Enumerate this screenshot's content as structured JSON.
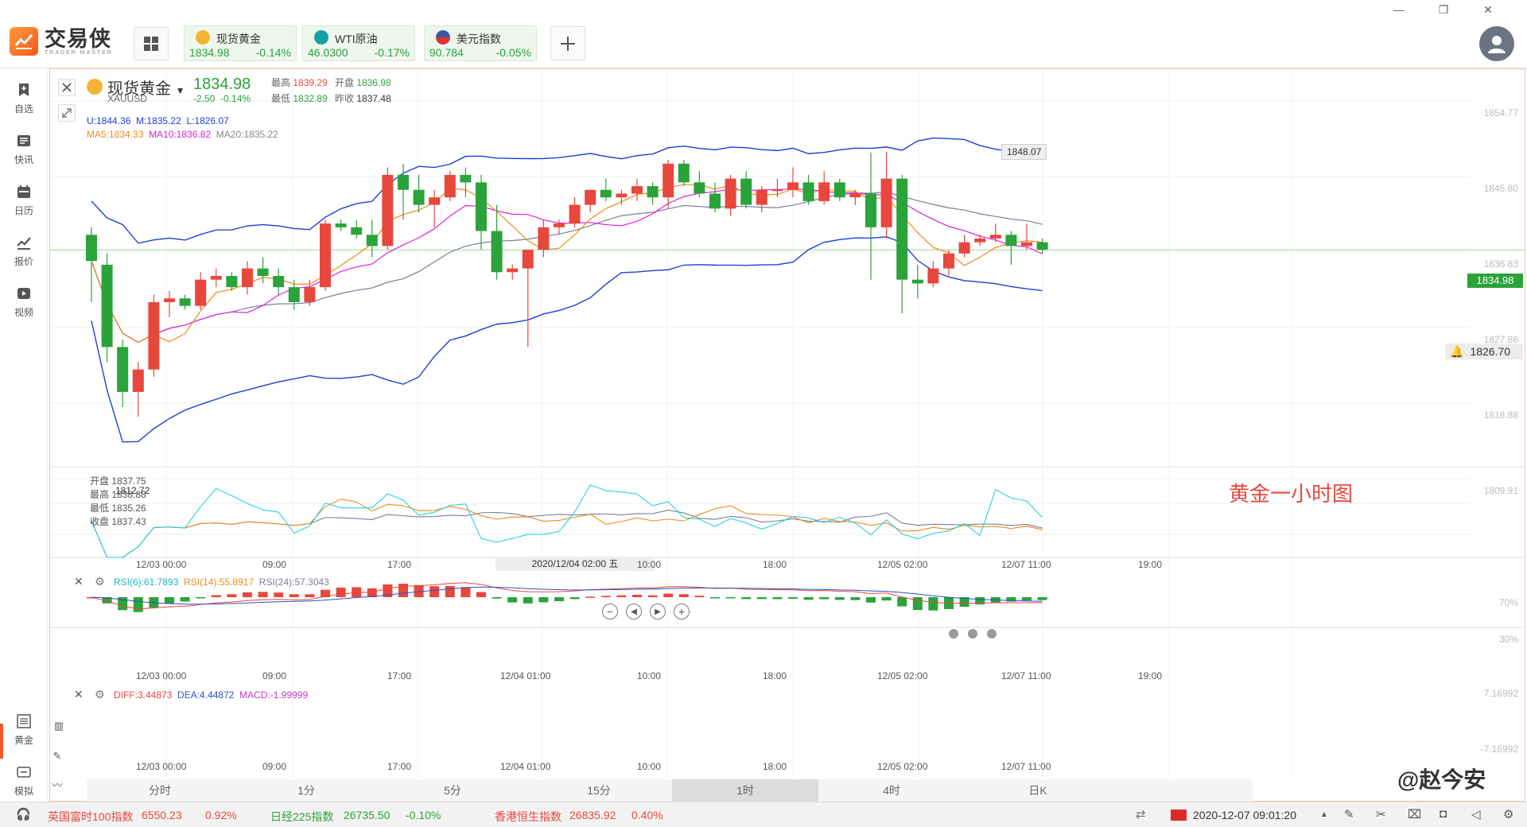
{
  "app": {
    "name_cn": "交易侠",
    "name_en": "TRADER MASTER"
  },
  "tickers": [
    {
      "name": "现货黄金",
      "price": "1834.98",
      "change": "-0.14%",
      "icon_color": "#f2b632"
    },
    {
      "name": "WTI原油",
      "price": "46.0300",
      "change": "-0.17%",
      "icon_color": "#16a0a6"
    },
    {
      "name": "美元指数",
      "price": "90.784",
      "change": "-0.05%",
      "icon_color": "#3a5aa0"
    }
  ],
  "sidebar": {
    "items": [
      {
        "label": "自选",
        "icon": "bookmark-plus-icon"
      },
      {
        "label": "快讯",
        "icon": "news-icon"
      },
      {
        "label": "日历",
        "icon": "calendar-icon"
      },
      {
        "label": "报价",
        "icon": "chart-line-icon"
      },
      {
        "label": "视频",
        "icon": "video-icon"
      }
    ],
    "bottom_items": [
      {
        "label": "黄金",
        "icon": "gold-icon"
      },
      {
        "label": "模拟",
        "icon": "simulate-icon"
      }
    ]
  },
  "symbol": {
    "name": "现货黄金",
    "code": "XAUUSD",
    "price": "1834.98",
    "change": "-2.50",
    "change_pct": "-0.14%",
    "high_label": "最高",
    "high": "1839.29",
    "open_label": "开盘",
    "open": "1836.98",
    "low_label": "最低",
    "low": "1832.89",
    "prev_label": "昨收",
    "prev": "1837.48"
  },
  "indicators": {
    "boll": {
      "u": "U:1844.36",
      "m": "M:1835.22",
      "l": "L:1826.07"
    },
    "ma": {
      "ma5": "MA5:1834.33",
      "ma10": "MA10:1836.82",
      "ma20": "MA20:1835.22"
    },
    "rsi": {
      "r6": "RSI(6):61.7893",
      "r14": "RSI(14):55.8917",
      "r24": "RSI(24):57.3043"
    },
    "macd": {
      "diff": "DIFF:3.44873",
      "dea": "DEA:4.44872",
      "macd": "MACD:-1.99999"
    }
  },
  "price_axis": [
    "1854.77",
    "1845.80",
    "1836.83",
    "1827.86",
    "1818.88",
    "1809.91"
  ],
  "rsi_axis": [
    "70%",
    "30%"
  ],
  "macd_axis": [
    "7.16992",
    "-7.16992"
  ],
  "time_axis": [
    "12/03 00:00",
    "09:00",
    "17:00",
    "10:00",
    "18:00",
    "12/05 02:00",
    "12/07 11:00",
    "19:00"
  ],
  "time_axis_sub": [
    "12/03 00:00",
    "09:00",
    "17:00",
    "12/04 01:00",
    "10:00",
    "18:00",
    "12/05 02:00",
    "12/07 11:00",
    "19:00"
  ],
  "crosshair_time": "2020/12/04 02:00 五",
  "tooltip_high": "1848.07",
  "tooltip_low": "1812.72",
  "current_price_tag": "1834.98",
  "alert_price": "1826.70",
  "ohlc_box": {
    "open": "开盘 1837.75",
    "high": "最高 1838.88",
    "low": "最低 1835.26",
    "close": "收盘 1837.43"
  },
  "periods": [
    "分时",
    "1分",
    "5分",
    "15分",
    "1时",
    "4时",
    "日K"
  ],
  "active_period": "1时",
  "annotation": "黄金一小时图",
  "watermark_author": "@赵今安",
  "bottom": {
    "ftse_name": "英国富时100指数",
    "ftse_val": "6550.23",
    "ftse_chg": "0.92%",
    "nikkei_name": "日经225指数",
    "nikkei_val": "26735.50",
    "nikkei_chg": "-0.10%",
    "hsi_name": "香港恒生指数",
    "hsi_val": "26835.92",
    "hsi_chg": "0.40%",
    "datetime": "2020-12-07 09:01:20"
  },
  "colors": {
    "up": "#e8473d",
    "down": "#2aa33a",
    "boll": "#1e3fd6",
    "ma5": "#f08a1c",
    "ma10": "#e020e0",
    "ma20": "#7a7f96",
    "rsi6": "#2ad0e0",
    "rsi14": "#f08a1c",
    "rsi24": "#7a7f96"
  },
  "chart_data": {
    "type": "candlestick",
    "title": "现货黄金",
    "candles": [
      [
        1837.0,
        1838.0,
        1828.0,
        1833.5
      ],
      [
        1833.0,
        1834.5,
        1820.0,
        1822.0
      ],
      [
        1822.0,
        1823.0,
        1814.0,
        1816.0
      ],
      [
        1816.0,
        1820.0,
        1812.7,
        1819.0
      ],
      [
        1819.0,
        1829.0,
        1818.0,
        1828.0
      ],
      [
        1828.0,
        1829.5,
        1826.0,
        1828.5
      ],
      [
        1828.5,
        1829.0,
        1827.0,
        1827.5
      ],
      [
        1827.5,
        1832.0,
        1827.0,
        1831.0
      ],
      [
        1831.0,
        1832.5,
        1830.0,
        1831.5
      ],
      [
        1831.5,
        1832.0,
        1829.5,
        1830.0
      ],
      [
        1830.0,
        1833.5,
        1829.0,
        1832.5
      ],
      [
        1832.5,
        1834.0,
        1830.5,
        1831.5
      ],
      [
        1831.5,
        1832.5,
        1829.0,
        1830.0
      ],
      [
        1830.0,
        1831.0,
        1827.0,
        1828.0
      ],
      [
        1828.0,
        1831.0,
        1827.5,
        1830.0
      ],
      [
        1830.0,
        1839.0,
        1829.5,
        1838.5
      ],
      [
        1838.5,
        1839.0,
        1837.5,
        1838.0
      ],
      [
        1838.0,
        1839.0,
        1836.5,
        1837.0
      ],
      [
        1837.0,
        1839.0,
        1834.0,
        1835.5
      ],
      [
        1835.5,
        1846.0,
        1835.0,
        1845.0
      ],
      [
        1845.0,
        1846.5,
        1839.0,
        1843.0
      ],
      [
        1843.0,
        1845.0,
        1840.0,
        1841.0
      ],
      [
        1841.0,
        1843.0,
        1838.0,
        1842.0
      ],
      [
        1842.0,
        1845.5,
        1841.5,
        1845.0
      ],
      [
        1845.0,
        1846.0,
        1842.0,
        1844.0
      ],
      [
        1844.0,
        1845.0,
        1835.0,
        1837.5
      ],
      [
        1837.5,
        1841.0,
        1831.0,
        1832.0
      ],
      [
        1832.0,
        1833.0,
        1831.0,
        1832.5
      ],
      [
        1832.5,
        1834.0,
        1822.0,
        1835.0
      ],
      [
        1835.0,
        1839.0,
        1834.0,
        1838.0
      ],
      [
        1838.0,
        1839.0,
        1837.0,
        1838.5
      ],
      [
        1838.5,
        1842.0,
        1838.0,
        1841.0
      ],
      [
        1841.0,
        1843.0,
        1840.0,
        1843.0
      ],
      [
        1843.0,
        1844.5,
        1841.5,
        1842.0
      ],
      [
        1842.0,
        1843.0,
        1841.0,
        1842.5
      ],
      [
        1842.5,
        1844.5,
        1841.5,
        1843.5
      ],
      [
        1843.5,
        1844.0,
        1841.0,
        1842.0
      ],
      [
        1842.0,
        1847.0,
        1840.5,
        1846.5
      ],
      [
        1846.5,
        1847.0,
        1843.5,
        1844.0
      ],
      [
        1844.0,
        1845.5,
        1842.0,
        1842.5
      ],
      [
        1842.5,
        1844.0,
        1840.0,
        1840.5
      ],
      [
        1840.5,
        1845.0,
        1839.5,
        1844.5
      ],
      [
        1844.5,
        1845.5,
        1840.5,
        1841.0
      ],
      [
        1841.0,
        1843.5,
        1840.0,
        1843.0
      ],
      [
        1843.0,
        1844.5,
        1842.0,
        1843.0
      ],
      [
        1843.0,
        1846.0,
        1842.0,
        1844.0
      ],
      [
        1844.0,
        1845.0,
        1841.0,
        1841.5
      ],
      [
        1841.5,
        1845.5,
        1841.0,
        1844.0
      ],
      [
        1844.0,
        1844.5,
        1841.5,
        1842.0
      ],
      [
        1842.0,
        1843.0,
        1841.0,
        1842.5
      ],
      [
        1842.5,
        1848.0,
        1831.0,
        1838.0
      ],
      [
        1838.0,
        1848.07,
        1836.5,
        1844.5
      ],
      [
        1844.5,
        1845.0,
        1826.5,
        1831.0
      ],
      [
        1831.0,
        1833.0,
        1828.5,
        1830.5
      ],
      [
        1830.5,
        1833.5,
        1830.0,
        1832.5
      ],
      [
        1832.5,
        1835.0,
        1831.5,
        1834.5
      ],
      [
        1834.5,
        1837.0,
        1834.0,
        1836.0
      ],
      [
        1836.0,
        1837.0,
        1835.5,
        1836.5
      ],
      [
        1836.5,
        1838.5,
        1836.0,
        1837.0
      ],
      [
        1837.0,
        1837.5,
        1833.0,
        1835.5
      ],
      [
        1835.5,
        1838.5,
        1835.0,
        1836.0
      ],
      [
        1836.0,
        1836.5,
        1834.5,
        1835.0
      ]
    ]
  }
}
